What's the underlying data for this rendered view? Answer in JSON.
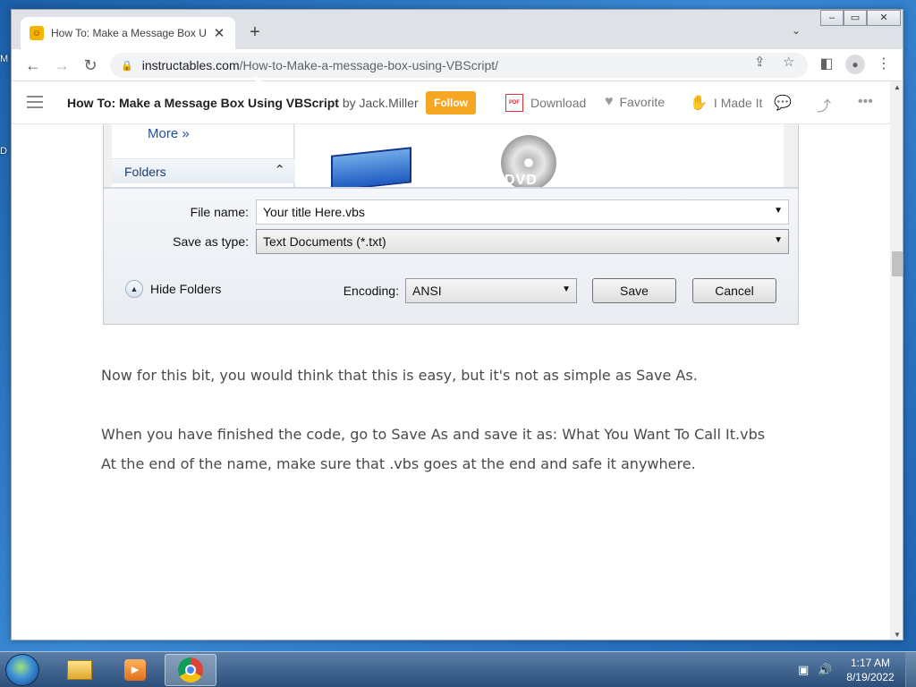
{
  "desktop": {
    "edge_letters": [
      "M",
      "D"
    ]
  },
  "browser": {
    "tab": {
      "title": "How To: Make a Message Box Us",
      "favicon": "instructables-robot-icon"
    },
    "url": {
      "host": "instructables.com",
      "path": "/How-to-Make-a-message-box-using-VBScript/"
    }
  },
  "site_bar": {
    "title": "How To: Make a Message Box Using VBScript",
    "by": "by Jack.Miller",
    "follow_label": "Follow",
    "download_label": "Download",
    "favorite_label": "Favorite",
    "made_it_label": "I Made It",
    "follow_color": "#f5a623"
  },
  "dialog": {
    "more_label": "More",
    "folders_label": "Folders",
    "dvd_label": "DVD",
    "file_name_label": "File name:",
    "file_name_value": "Your title Here.vbs",
    "save_type_label": "Save as type:",
    "save_type_value": "Text Documents (*.txt)",
    "hide_folders_label": "Hide Folders",
    "encoding_label": "Encoding:",
    "encoding_value": "ANSI",
    "save_label": "Save",
    "cancel_label": "Cancel"
  },
  "article": {
    "para1": "Now for this bit, you would think that this is easy, but it's not as simple as Save As.",
    "para2_line1": "When you have finished the code, go to Save As and save it as: What You Want To Call It.vbs",
    "para2_line2": "At the end of the name, make sure that .vbs goes at the end and safe it anywhere."
  },
  "taskbar": {
    "time": "1:17 AM",
    "date": "8/19/2022"
  }
}
